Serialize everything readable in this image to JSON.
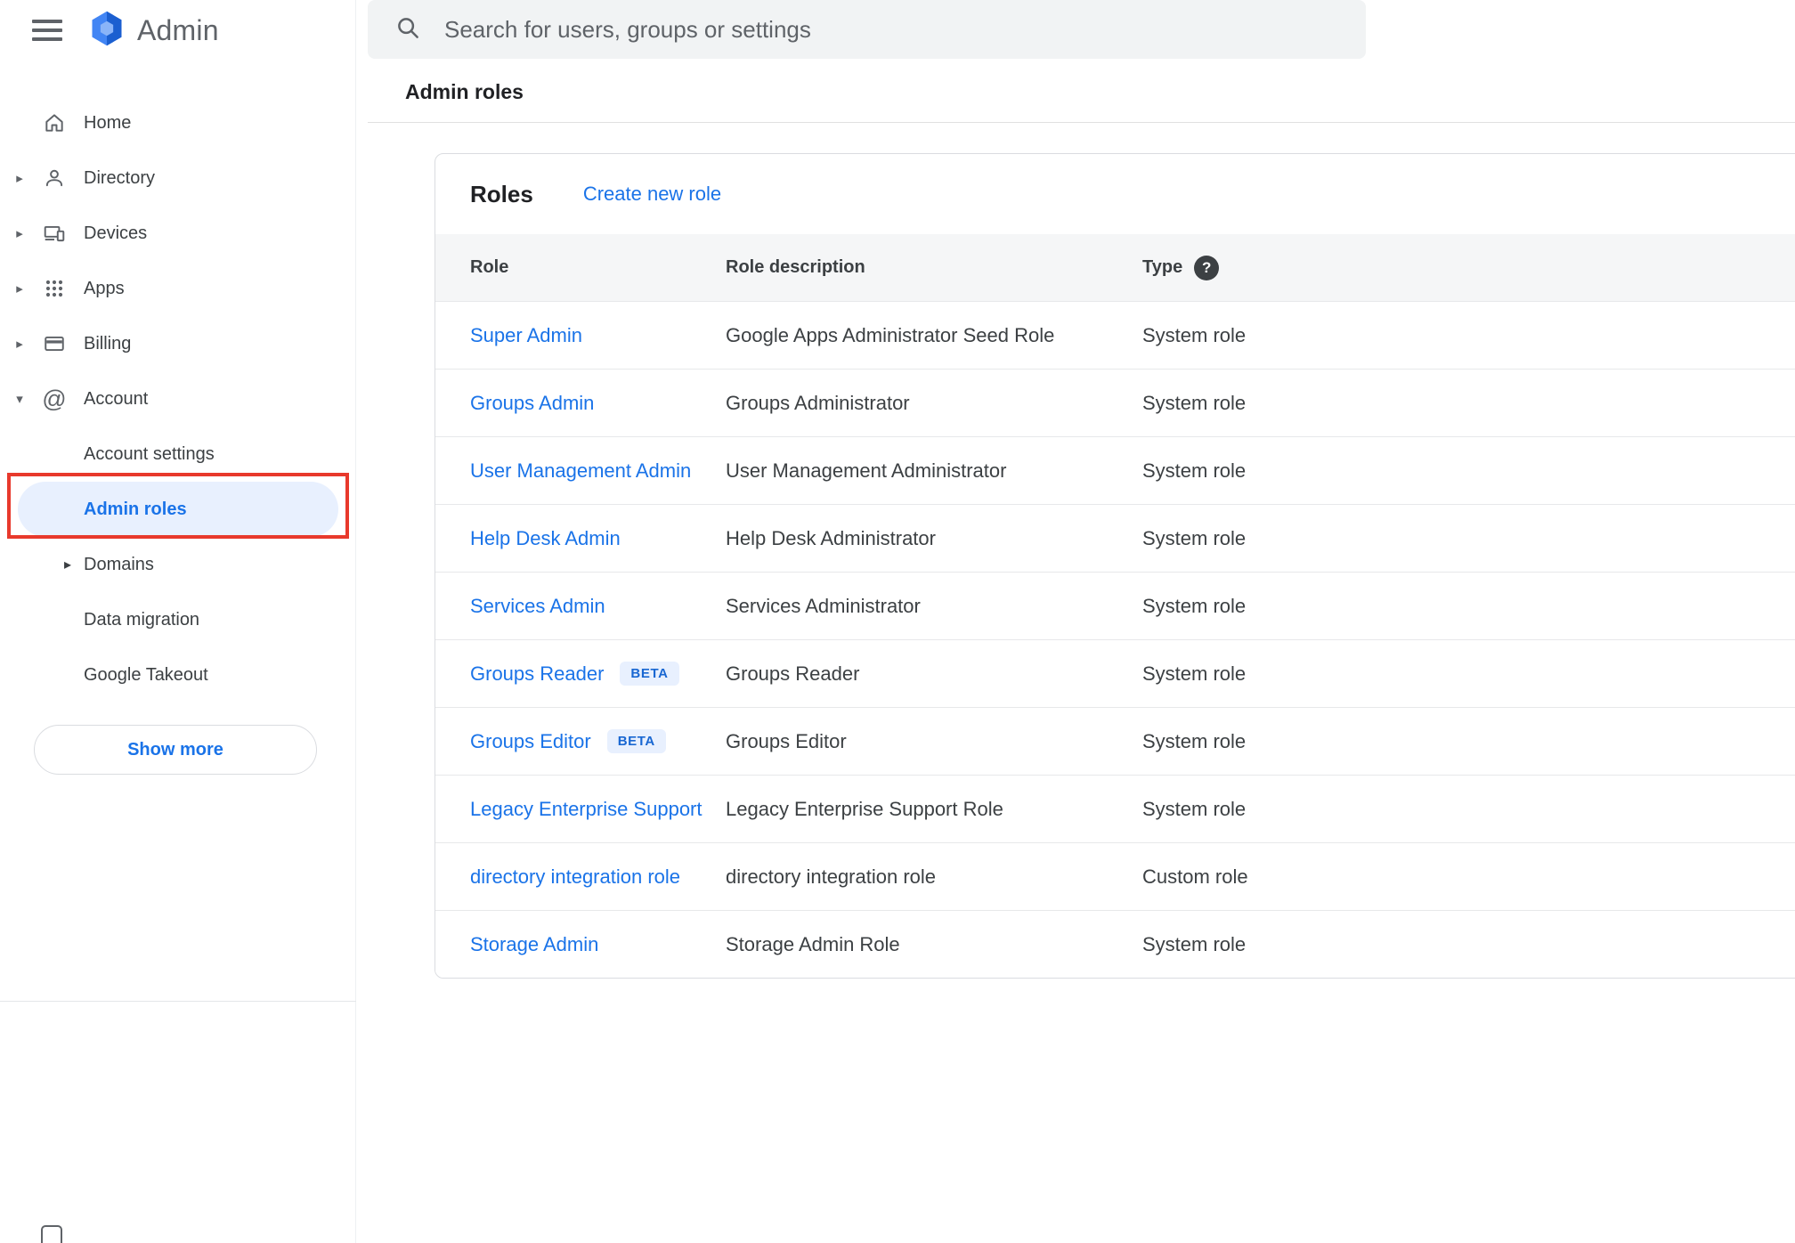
{
  "sidebar": {
    "logo_text": "Admin",
    "items": [
      {
        "label": "Home"
      },
      {
        "label": "Directory"
      },
      {
        "label": "Devices"
      },
      {
        "label": "Apps"
      },
      {
        "label": "Billing"
      },
      {
        "label": "Account"
      }
    ],
    "account_subitems": [
      {
        "label": "Account settings"
      },
      {
        "label": "Admin roles",
        "active": true
      },
      {
        "label": "Domains"
      },
      {
        "label": "Data migration"
      },
      {
        "label": "Google Takeout"
      }
    ],
    "show_more_label": "Show more"
  },
  "search": {
    "placeholder": "Search for users, groups or settings"
  },
  "page": {
    "title": "Admin roles"
  },
  "icons": {
    "chevron_right": "▸",
    "chevron_down": "▾",
    "at": "@",
    "help_glyph": "?"
  },
  "roles_card": {
    "heading": "Roles",
    "create_link": "Create new role",
    "columns": {
      "role": "Role",
      "description": "Role description",
      "type": "Type"
    },
    "rows": [
      {
        "role": "Super Admin",
        "description": "Google Apps Administrator Seed Role",
        "type": "System role"
      },
      {
        "role": "Groups Admin",
        "description": "Groups Administrator",
        "type": "System role"
      },
      {
        "role": "User Management Admin",
        "description": "User Management Administrator",
        "type": "System role"
      },
      {
        "role": "Help Desk Admin",
        "description": "Help Desk Administrator",
        "type": "System role"
      },
      {
        "role": "Services Admin",
        "description": "Services Administrator",
        "type": "System role"
      },
      {
        "role": "Groups Reader",
        "badge": "BETA",
        "description": "Groups Reader",
        "type": "System role"
      },
      {
        "role": "Groups Editor",
        "badge": "BETA",
        "description": "Groups Editor",
        "type": "System role"
      },
      {
        "role": "Legacy Enterprise Support",
        "description": "Legacy Enterprise Support Role",
        "type": "System role"
      },
      {
        "role": "directory integration role",
        "description": "directory integration role",
        "type": "Custom role"
      },
      {
        "role": "Storage Admin",
        "description": "Storage Admin Role",
        "type": "System role"
      }
    ]
  },
  "colors": {
    "accent_blue": "#1a73e8",
    "annotation_red": "#e8392c",
    "active_item_bg": "#e8f0fe",
    "badge_bg": "#e8f0fe",
    "badge_text": "#1967d2",
    "search_bg": "#f1f3f4",
    "table_header_bg": "#f5f6f7",
    "divider": "#e0e0e0",
    "text_primary": "#202124",
    "text_secondary": "#3c4043",
    "icon_gray": "#5f6368"
  }
}
